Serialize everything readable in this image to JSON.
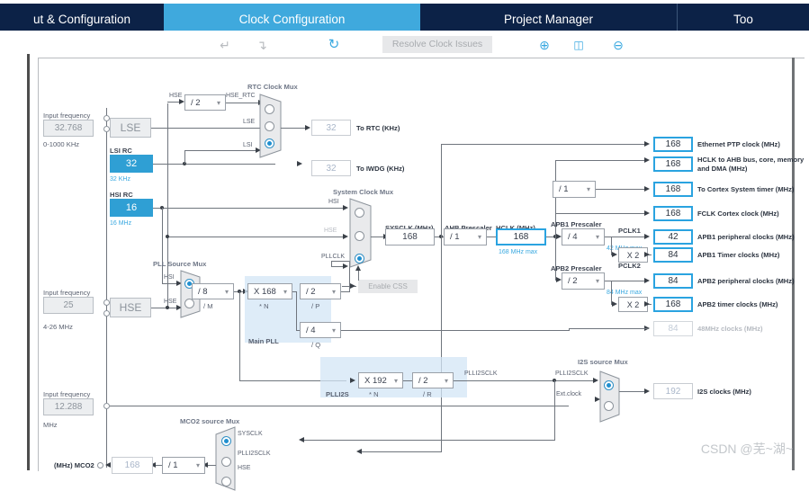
{
  "tabs": [
    {
      "label": "ut & Configuration",
      "state": "inactive"
    },
    {
      "label": "Clock Configuration",
      "state": "active"
    },
    {
      "label": "Project Manager",
      "state": "inactive"
    },
    {
      "label": "Too",
      "state": "inactive"
    }
  ],
  "toolbar": {
    "undo_icon": "undo-icon",
    "redo_icon": "redo-icon",
    "reset_icon": "refresh-icon",
    "resolve_label": "Resolve Clock Issues",
    "zoom_in_icon": "zoom-in-icon",
    "fit_icon": "fit-to-screen-icon",
    "zoom_out_icon": "zoom-out-icon"
  },
  "inputs": {
    "lse": {
      "caption": "Input frequency",
      "value": "32.768",
      "range": "0-1000 KHz",
      "name": "LSE"
    },
    "hse": {
      "caption": "Input frequency",
      "value": "25",
      "range": "4-26 MHz",
      "name": "HSE"
    },
    "i2s": {
      "caption": "Input frequency",
      "value": "12.288",
      "range": "MHz"
    }
  },
  "oscillators": {
    "lsi": {
      "title": "LSI RC",
      "value": "32",
      "sub": "32 KHz"
    },
    "hsi": {
      "title": "HSI RC",
      "value": "16",
      "sub": "16 MHz"
    }
  },
  "rtc": {
    "mux_title": "RTC Clock Mux",
    "hse_label": "HSE",
    "hse_div": "/ 2",
    "hse_rtc_label": "HSE_RTC",
    "lse_label": "LSE",
    "lsi_label": "LSI",
    "selected": "LSI",
    "to_rtc_value": "32",
    "to_rtc_label": "To RTC (KHz)",
    "to_iwdg_value": "32",
    "to_iwdg_label": "To IWDG (KHz)"
  },
  "sysclk": {
    "mux_title": "System Clock Mux",
    "src_hsi": "HSI",
    "src_hse": "HSE",
    "src_pllclk": "PLLCLK",
    "selected": "PLLCLK",
    "enable_css": "Enable CSS",
    "sysclk_label": "SYSCLK (MHz)",
    "sysclk_value": "168",
    "ahb_prescaler_label": "AHB Prescaler",
    "ahb_prescaler_value": "/ 1",
    "hclk_label": "HCLK (MHz)",
    "hclk_value": "168",
    "hclk_max": "168 MHz max"
  },
  "pll": {
    "source_mux_title": "PLL Source Mux",
    "src_hsi": "HSI",
    "src_hse": "HSE",
    "selected": "HSI",
    "m_value": "/ 8",
    "m_label": "/ M",
    "n_value": "X 168",
    "n_label": "* N",
    "p_value": "/ 2",
    "p_label": "/ P",
    "q_value": "/ 4",
    "q_label": "/ Q",
    "panel_label": "Main PLL"
  },
  "plli2s": {
    "panel_label": "PLLI2S",
    "n_value": "X 192",
    "n_label": "* N",
    "r_value": "/ 2",
    "r_label": "/ R",
    "out_label": "PLLI2SCLK"
  },
  "i2s_mux": {
    "title": "I2S source Mux",
    "src_plli2sclk": "PLLI2SCLK",
    "src_ext": "Ext.clock",
    "selected": "PLLI2SCLK",
    "value": "192",
    "label": "I2S clocks (MHz)"
  },
  "mco2": {
    "title": "MCO2 source Mux",
    "src_sysclk": "SYSCLK",
    "src_plli2sclk": "PLLI2SCLK",
    "src_hse": "HSE",
    "selected": "SYSCLK",
    "div_value": "/ 1",
    "value": "168",
    "label": "(MHz) MCO2"
  },
  "outputs": [
    {
      "value": "168",
      "label": "Ethernet PTP clock (MHz)",
      "style": "blue"
    },
    {
      "value": "168",
      "label": "HCLK to AHB bus, core, memory and DMA (MHz)",
      "style": "blue"
    },
    {
      "value": "168",
      "label": "To Cortex System timer (MHz)",
      "style": "blue"
    },
    {
      "value": "168",
      "label": "FCLK Cortex clock (MHz)",
      "style": "blue"
    }
  ],
  "cortex_prescaler": "/ 1",
  "apb1": {
    "prescaler_label": "APB1 Prescaler",
    "prescaler_value": "/ 4",
    "pclk_label": "PCLK1",
    "pclk_max": "42 MHz max",
    "periph_value": "42",
    "periph_label": "APB1 peripheral clocks (MHz)",
    "mult": "X 2",
    "timer_value": "84",
    "timer_label": "APB1 Timer clocks (MHz)"
  },
  "apb2": {
    "prescaler_label": "APB2 Prescaler",
    "prescaler_value": "/ 2",
    "pclk_label": "PCLK2",
    "pclk_max": "84 MHz max",
    "periph_value": "84",
    "periph_label": "APB2 peripheral clocks (MHz)",
    "mult": "X 2",
    "timer_value": "168",
    "timer_label": "APB2 timer clocks (MHz)"
  },
  "clk48": {
    "value": "84",
    "label": "48MHz clocks (MHz)"
  },
  "watermark": "CSDN @芜~湖~",
  "colors": {
    "accent": "#38a8e0",
    "tab_dark": "#0c2247",
    "osc_fill": "#2f9fd4",
    "panel": "#d3e6f5"
  }
}
